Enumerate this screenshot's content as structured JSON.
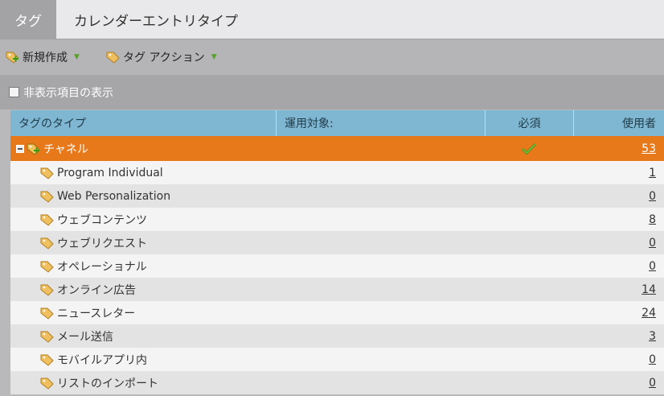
{
  "tabs": {
    "active": "タグ",
    "inactive": "カレンダーエントリタイプ"
  },
  "toolbar": {
    "new_label": "新規作成",
    "tag_action_label": "タグ アクション"
  },
  "filter": {
    "show_hidden_label": "非表示項目の表示"
  },
  "grid": {
    "headers": {
      "type": "タグのタイプ",
      "applies_to": "運用対象:",
      "required": "必須",
      "used_by": "使用者"
    },
    "group": {
      "name": "チャネル",
      "required": true,
      "count": "53"
    },
    "rows": [
      {
        "name": "Program Individual",
        "count": "1"
      },
      {
        "name": "Web Personalization",
        "count": "0"
      },
      {
        "name": "ウェブコンテンツ",
        "count": "8"
      },
      {
        "name": "ウェブリクエスト",
        "count": "0"
      },
      {
        "name": "オペレーショナル",
        "count": "0"
      },
      {
        "name": "オンライン広告",
        "count": "14"
      },
      {
        "name": "ニュースレター",
        "count": "24"
      },
      {
        "name": "メール送信",
        "count": "3"
      },
      {
        "name": "モバイルアプリ内",
        "count": "0"
      },
      {
        "name": "リストのインポート",
        "count": "0"
      }
    ]
  },
  "colors": {
    "group_row": "#e8791a",
    "header": "#7fb6d1",
    "check": "#4a9a1a"
  }
}
